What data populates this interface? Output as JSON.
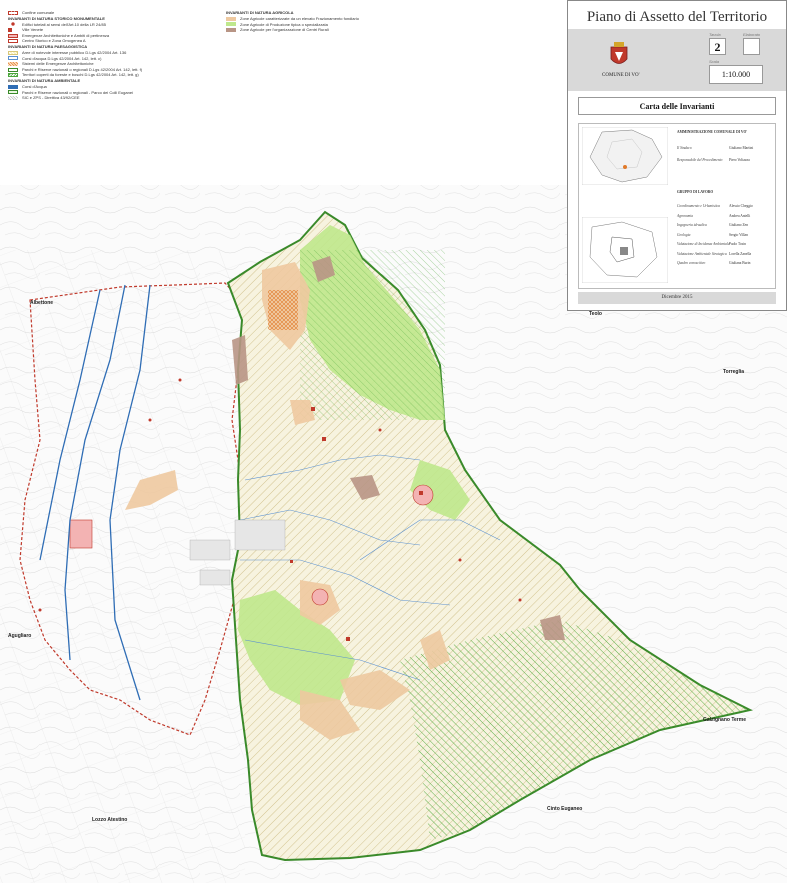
{
  "legend_left": [
    {
      "type": "item",
      "label": "Confine comunale",
      "swatch": "dotted-red"
    },
    {
      "type": "header",
      "label": "INVARIANTI DI NATURA STORICO MONUMENTALE"
    },
    {
      "type": "item",
      "label": "Edifici tutelati ai sensi dell'Art.10 della LR 24/85",
      "swatch": "star-red"
    },
    {
      "type": "item",
      "label": "Ville Venete",
      "swatch": "square-red"
    },
    {
      "type": "item",
      "label": "Emergenze Architettoniche e Ambiti di pertinenza",
      "swatch": "pink-fill"
    },
    {
      "type": "item",
      "label": "Centro Storico e Zona Omogenea A",
      "swatch": "red-outline"
    },
    {
      "type": "header",
      "label": "INVARIANTI DI NATURA PAESAGGISTICA"
    },
    {
      "type": "item",
      "label": "Aree di notevole interesse pubblico D.Lgs 42/2004 Art. 136",
      "swatch": "yellow-hatch"
    },
    {
      "type": "item",
      "label": "Corsi d'acqua D.Lgs 42/2004 Art. 142, lett. c)",
      "swatch": "blue-outline"
    },
    {
      "type": "item",
      "label": "Sistemi delle Emergenze Architettoniche",
      "swatch": "orange-cross"
    },
    {
      "type": "item",
      "label": "Parchi e Riserve nazionali o regionali D.Lgs 42/2004 Art. 142, lett. f)",
      "swatch": "green-outline"
    },
    {
      "type": "item",
      "label": "Territori coperti da foreste e boschi D.Lgs 42/2004 Art. 142, lett. g)",
      "swatch": "green-hatch"
    },
    {
      "type": "header",
      "label": "INVARIANTI DI NATURA AMBIENTALE"
    },
    {
      "type": "item",
      "label": "Corsi d'Acqua",
      "swatch": "blue-fill"
    },
    {
      "type": "item",
      "label": "Parchi e Riserve nazionali o regionali - Parco dei Colli Euganei",
      "swatch": "green-line"
    },
    {
      "type": "item",
      "label": "SIC e ZPS - Direttiva 43/92/CEE",
      "swatch": "grey-hatch"
    }
  ],
  "legend_right": [
    {
      "type": "header",
      "label": "INVARIANTI DI NATURA AGRICOLA"
    },
    {
      "type": "item",
      "label": "Zone Agricole caratterizzate da un elevato Frazionamento fondiario",
      "swatch": "tan-fill"
    },
    {
      "type": "item",
      "label": "Zone Agricole di Produzione tipica o specializzata",
      "swatch": "lightgreen-fill"
    },
    {
      "type": "item",
      "label": "Zone Agricole per l'organizzazione di Centri Rurali",
      "swatch": "brown-fill"
    }
  ],
  "places": {
    "teolo": "Teolo",
    "torreglia": "Torreglia",
    "albettone": "Albettone",
    "agugliaro": "Agugliaro",
    "galzignano": "Galzignano Terme",
    "lozzo": "Lozzo Atestino",
    "cinto": "Cinto Euganeo"
  },
  "cartiglio": {
    "title": "Piano di Assetto del Territorio",
    "tavola_label": "Tavola",
    "tavola": "2",
    "elaborato_label": "Elaborato",
    "elaborato": "",
    "scala_label": "Scala",
    "scala": "1:10.000",
    "comune": "COMUNE DI VO'",
    "subtitle": "Carta delle Invarianti",
    "amministrazione": "AMMINISTRAZIONE COMUNALE DI VO'",
    "sindaco_label": "Il Sindaco",
    "sindaco": "Giuliano Martini",
    "responsabile_label": "Responsabile del Procedimento",
    "responsabile": "Piero Voltazza",
    "gruppo": "GRUPPO DI LAVORO",
    "team": [
      {
        "role": "Coordinamento e Urbanistica",
        "name": "Alessio Cheggio"
      },
      {
        "role": "Agronomia",
        "name": "Andrea Antelli"
      },
      {
        "role": "Ingegneria idraulica",
        "name": "Giuliano Zen"
      },
      {
        "role": "Geologia",
        "name": "Sergio Villan"
      },
      {
        "role": "Valutazione di Incidenza Ambientale",
        "name": "Paolo Tosin"
      },
      {
        "role": "Valutazione Ambientale Strategica",
        "name": "Lorella Zanella"
      },
      {
        "role": "Quadro conoscitivo",
        "name": "Giuliana Burin"
      }
    ],
    "date": "Dicembre 2015"
  },
  "colors": {
    "boundary": "#c0392b",
    "park_outline": "#3a8a2a",
    "lightgreen": "#bfe88c",
    "tan": "#eec9a0",
    "brown": "#b89585",
    "water": "#2f6db5",
    "hatch": "#b8a25a"
  }
}
